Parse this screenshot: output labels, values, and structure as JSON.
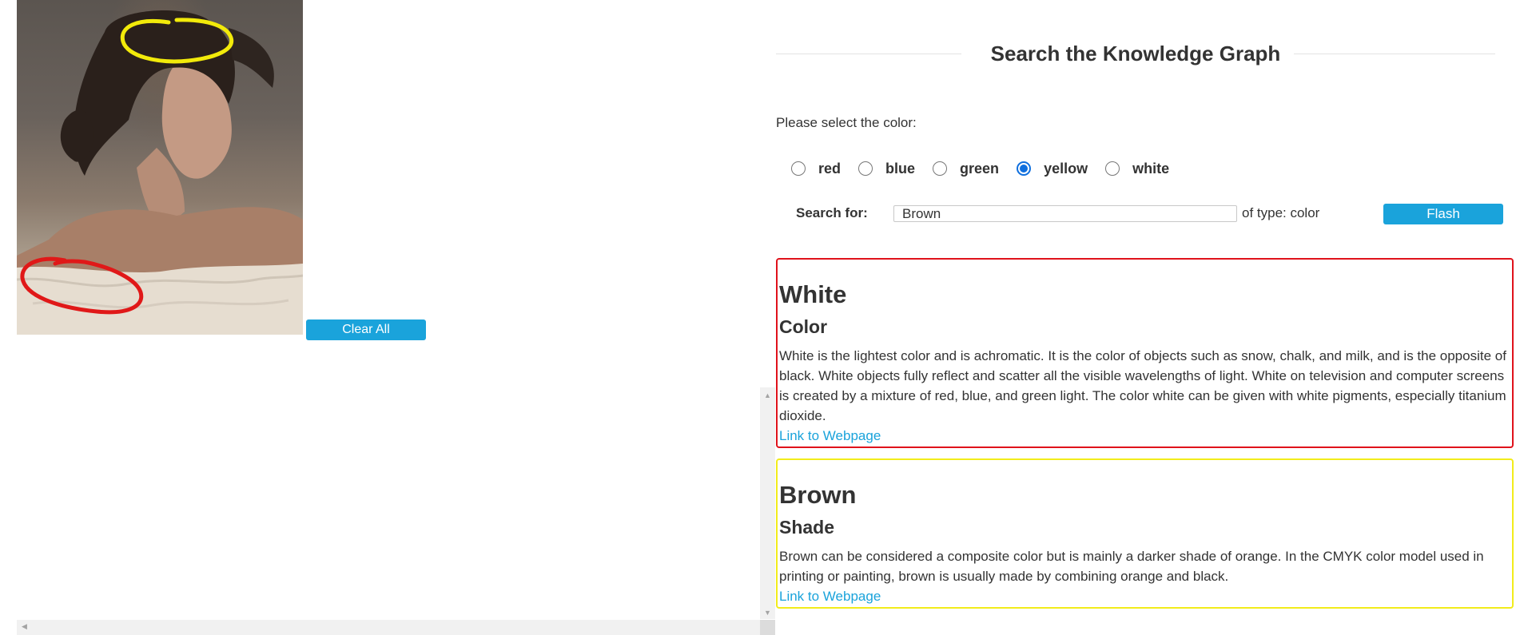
{
  "canvas": {
    "clear_label": "Clear All",
    "annotation_colors": [
      "#f2ea0a",
      "#e01818"
    ]
  },
  "search_panel": {
    "title": "Search the Knowledge Graph",
    "select_label": "Please select the color:",
    "color_options": [
      {
        "label": "red",
        "checked": false
      },
      {
        "label": "blue",
        "checked": false
      },
      {
        "label": "green",
        "checked": false
      },
      {
        "label": "yellow",
        "checked": true
      },
      {
        "label": "white",
        "checked": false
      }
    ],
    "search_label": "Search for:",
    "search_value": "Brown",
    "type_text": "of type: color",
    "flash_label": "Flash"
  },
  "results": [
    {
      "name": "White",
      "type": "Color",
      "border_color": "#e0121b",
      "description": "White is the lightest color and is achromatic. It is the color of objects such as snow, chalk, and milk, and is the opposite of black. White objects fully reflect and scatter all the visible wavelengths of light. White on television and computer screens is created by a mixture of red, blue, and green light. The color white can be given with white pigments, especially titanium dioxide.",
      "link_label": "Link to Webpage"
    },
    {
      "name": "Brown",
      "type": "Shade",
      "border_color": "#f2ec1b",
      "description": "Brown can be considered a composite color but is mainly a darker shade of orange. In the CMYK color model used in printing or painting, brown is usually made by combining orange and black.",
      "link_label": "Link to Webpage"
    }
  ],
  "colors": {
    "accent": "#1aa3db",
    "text": "#333333",
    "radio_checked": "#0f6fde"
  }
}
